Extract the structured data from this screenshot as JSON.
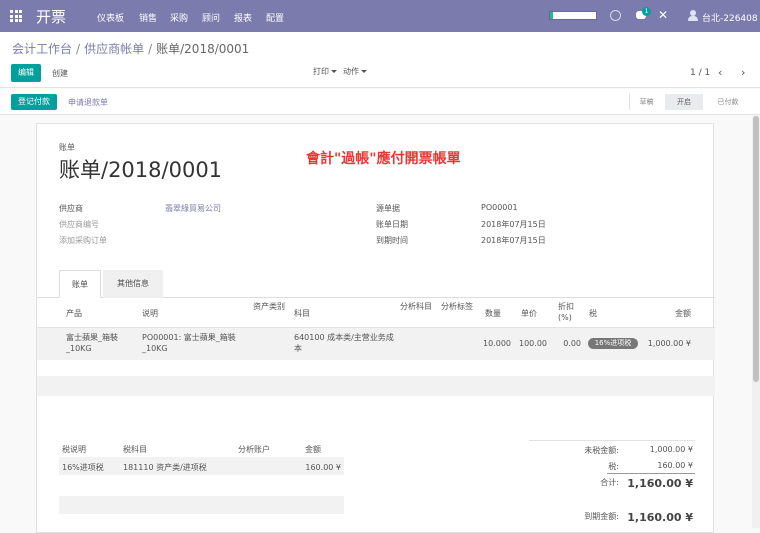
{
  "topbar": {
    "brand": "开票",
    "menu": [
      "仪表板",
      "销售",
      "采购",
      "顾问",
      "报表",
      "配置"
    ],
    "notif_count": "1",
    "user": "台北-226408",
    "colors": {
      "bar": "#7c7bad",
      "accent": "#00a09d"
    }
  },
  "breadcrumb": {
    "part1": "会计工作台",
    "part2": "供应商帐单",
    "current": "账单/2018/0001",
    "sep": "/"
  },
  "toolbar": {
    "edit": "编辑",
    "create": "创建",
    "print": "打印",
    "action": "动作",
    "pager": "1 / 1"
  },
  "statusbar": {
    "register_payment": "登记付款",
    "ask_refund": "申请退款单",
    "stages": [
      "草稿",
      "开启",
      "已付款"
    ],
    "active_stage": "开启"
  },
  "doc": {
    "type_label": "账单",
    "title": "账单/2018/0001",
    "annotation": "會計\"過帳\"應付開票帳單",
    "fields_left": [
      {
        "label": "供应商",
        "value": "翡翠綠貿易公司"
      },
      {
        "label": "供应商编号",
        "value": ""
      },
      {
        "label": "添加采购订单",
        "value": ""
      }
    ],
    "fields_right": [
      {
        "label": "源单据",
        "value": "PO00001"
      },
      {
        "label": "账单日期",
        "value": "2018年07月15日"
      },
      {
        "label": "到期时间",
        "value": "2018年07月15日"
      }
    ]
  },
  "tabs": [
    "账单",
    "其他信息"
  ],
  "lines": {
    "headers": [
      "产品",
      "说明",
      "资产类别",
      "科目",
      "分析科目",
      "分析标签",
      "数量",
      "单价",
      "折扣(%)",
      "税",
      "金额"
    ],
    "rows": [
      {
        "product": "富士蘋果_箱裝_10KG",
        "desc": "PO00001: 富士蘋果_箱裝_10KG",
        "asset": "",
        "account": "640100 成本类/主营业务成本",
        "analytic": "",
        "tags": "",
        "qty": "10.000",
        "price": "100.00",
        "discount": "0.00",
        "tax": "16%进项税",
        "amount": "1,000.00 ¥"
      }
    ]
  },
  "taxes": {
    "headers": [
      "税说明",
      "税科目",
      "分析账户",
      "金额"
    ],
    "rows": [
      {
        "desc": "16%进项税",
        "account": "181110 资产类/进项税",
        "analytic": "",
        "amount": "160.00 ¥"
      }
    ]
  },
  "totals": {
    "untaxed_label": "未税金额:",
    "untaxed": "1,000.00 ¥",
    "tax_label": "税:",
    "tax": "160.00 ¥",
    "total_label": "合计:",
    "total": "1,160.00 ¥",
    "due_label": "到期金额:",
    "due": "1,160.00 ¥"
  }
}
